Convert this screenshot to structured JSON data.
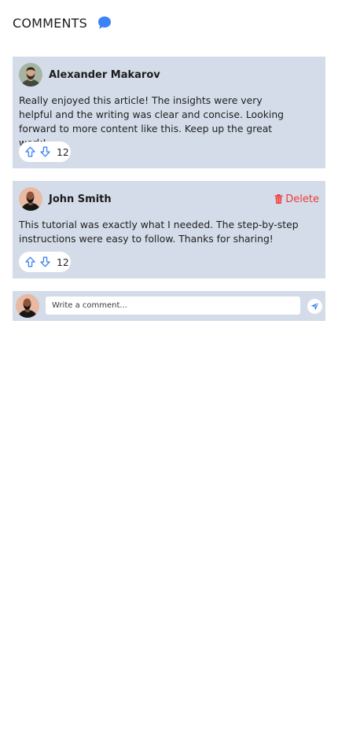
{
  "header": {
    "title": "COMMENTS",
    "icon": "chat-bubble-icon",
    "accent": "#3b82f6"
  },
  "comments": [
    {
      "author": "Alexander Makarov",
      "avatar": "avatar-alexander",
      "text": "Really enjoyed this article! The insights were very helpful and the writing was clear and concise. Looking forward to more content like this. Keep up the great work!",
      "votes": "12"
    },
    {
      "author": "John Smith",
      "avatar": "avatar-john",
      "text": "This tutorial was exactly what I needed. The step-by-step instructions were easy to follow. Thanks for sharing!",
      "votes": "12",
      "delete_label": "Delete"
    }
  ],
  "composer": {
    "placeholder": "Write a comment..."
  },
  "colors": {
    "card_bg": "#d3dce8",
    "delete": "#ef3b3b",
    "icon_blue": "#3b82f6"
  }
}
